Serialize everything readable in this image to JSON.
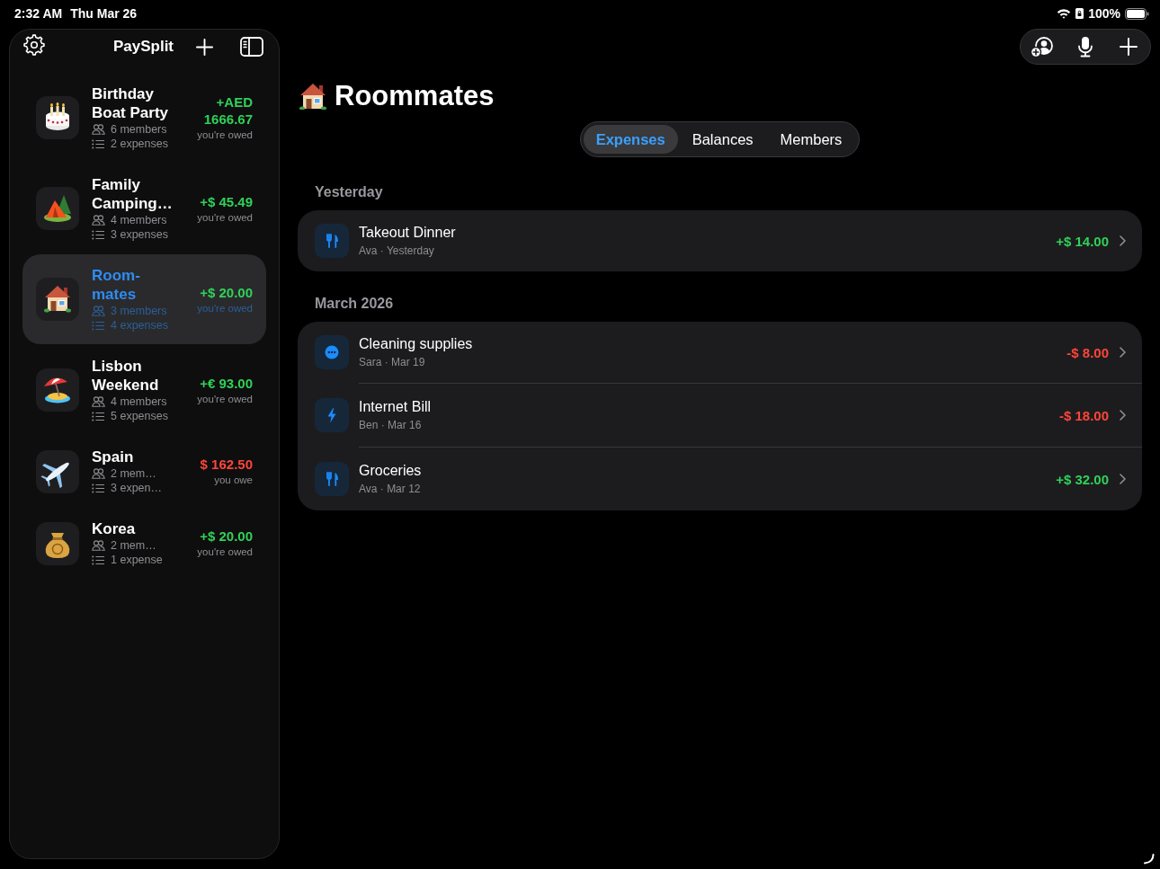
{
  "status_bar": {
    "time": "2:32 AM",
    "date": "Thu Mar 26",
    "battery": "100%"
  },
  "sidebar": {
    "title": "PaySplit",
    "groups": [
      {
        "kind": "cake",
        "name": "Birthday Boat Party",
        "members": "6 members",
        "expenses": "2 expenses",
        "amount": "+AED 1666.67",
        "note": "you're owed",
        "owed": true,
        "selected": false
      },
      {
        "kind": "tent",
        "name": "Family Camping…",
        "members": "4 members",
        "expenses": "3 expenses",
        "amount": "+$ 45.49",
        "note": "you're owed",
        "owed": true,
        "selected": false
      },
      {
        "kind": "house",
        "name": "Room-mates",
        "members": "3 members",
        "expenses": "4 expenses",
        "amount": "+$ 20.00",
        "note": "you're owed",
        "owed": true,
        "selected": true
      },
      {
        "kind": "beach",
        "name": "Lisbon Weekend",
        "members": "4 members",
        "expenses": "5 expenses",
        "amount": "+€ 93.00",
        "note": "you're owed",
        "owed": true,
        "selected": false
      },
      {
        "kind": "plane",
        "name": "Spain",
        "members": "2 mem…",
        "expenses": "3 expen…",
        "amount": "$ 162.50",
        "note": "you owe",
        "owed": false,
        "selected": false
      },
      {
        "kind": "moneybag",
        "name": "Korea",
        "members": "2 mem…",
        "expenses": "1 expense",
        "amount": "+$ 20.00",
        "note": "you're owed",
        "owed": true,
        "selected": false
      }
    ]
  },
  "main": {
    "kind": "house",
    "title": "Roommates",
    "tabs": [
      {
        "label": "Expenses",
        "selected": true
      },
      {
        "label": "Balances",
        "selected": false
      },
      {
        "label": "Members",
        "selected": false
      }
    ],
    "sections": [
      {
        "header": "Yesterday",
        "expenses": [
          {
            "kind": "dining",
            "title": "Takeout Dinner",
            "subtitle": "Ava · Yesterday",
            "amount": "+$ 14.00",
            "owed": true
          }
        ]
      },
      {
        "header": "March 2026",
        "expenses": [
          {
            "kind": "misc",
            "title": "Cleaning supplies",
            "subtitle": "Sara · Mar 19",
            "amount": "-$ 8.00",
            "owed": false
          },
          {
            "kind": "utilities",
            "title": "Internet Bill",
            "subtitle": "Ben · Mar 16",
            "amount": "-$ 18.00",
            "owed": false
          },
          {
            "kind": "dining",
            "title": "Groceries",
            "subtitle": "Ava · Mar 12",
            "amount": "+$ 32.00",
            "owed": true
          }
        ]
      }
    ]
  }
}
